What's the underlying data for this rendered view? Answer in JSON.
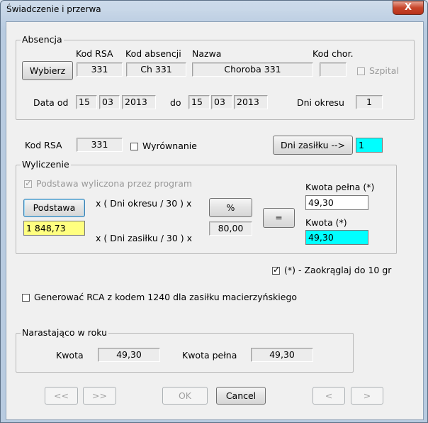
{
  "window": {
    "title": "Świadczenie i przerwa",
    "close": "X"
  },
  "absencja": {
    "group_title": "Absencja",
    "headers": {
      "kod_rsa": "Kod RSA",
      "kod_absencji": "Kod absencji",
      "nazwa": "Nazwa",
      "kod_chor": "Kod chor."
    },
    "wybierz_label": "Wybierz",
    "kod_rsa": "331",
    "kod_absencji": "Ch 331",
    "nazwa": "Choroba 331",
    "kod_chor": "",
    "szpital_label": "Szpital",
    "data_od_label": "Data od",
    "data_od": {
      "day": "15",
      "month": "03",
      "year": "2013"
    },
    "do_label": "do",
    "data_do": {
      "day": "15",
      "month": "03",
      "year": "2013"
    },
    "dni_okresu_label": "Dni okresu",
    "dni_okresu": "1"
  },
  "row2": {
    "kod_rsa_label": "Kod RSA",
    "kod_rsa": "331",
    "wyrownanie_label": "Wyrównanie",
    "dni_zasilku_button": "Dni zasiłku -->",
    "dni_zasilku_value": "1"
  },
  "wyliczenie": {
    "group_title": "Wyliczenie",
    "podstawa_checkbox_label": "Podstawa wyliczona przez program",
    "podstawa_button": "Podstawa",
    "podstawa_value": "1 848,73",
    "formula_1": "x ( Dni okresu / 30 ) x",
    "formula_2": "x ( Dni zasiłku / 30 ) x",
    "percent_button": "%",
    "percent_value": "80,00",
    "equals_button": "=",
    "kwota_pelna_label": "Kwota pełna (*)",
    "kwota_pelna_value": "49,30",
    "kwota_label": "Kwota (*)",
    "kwota_value": "49,30"
  },
  "zaokraglaj": {
    "label": "(*) - Zaokrąglaj do 10 gr",
    "checked": true
  },
  "generowac": {
    "label": "Generować RCA z kodem 1240 dla zasiłku macierzyńskiego",
    "checked": false
  },
  "narastajaco": {
    "group_title": "Narastająco w roku",
    "kwota_label": "Kwota",
    "kwota_value": "49,30",
    "kwota_pelna_label": "Kwota pełna",
    "kwota_pelna_value": "49,30"
  },
  "footer": {
    "first_label": "<<",
    "next_label": ">>",
    "ok_label": "OK",
    "cancel_label": "Cancel",
    "prev_label": "<",
    "fwd_label": ">"
  },
  "colors": {
    "yellow_field": "#ffff80",
    "cyan_field": "#00ffff"
  }
}
